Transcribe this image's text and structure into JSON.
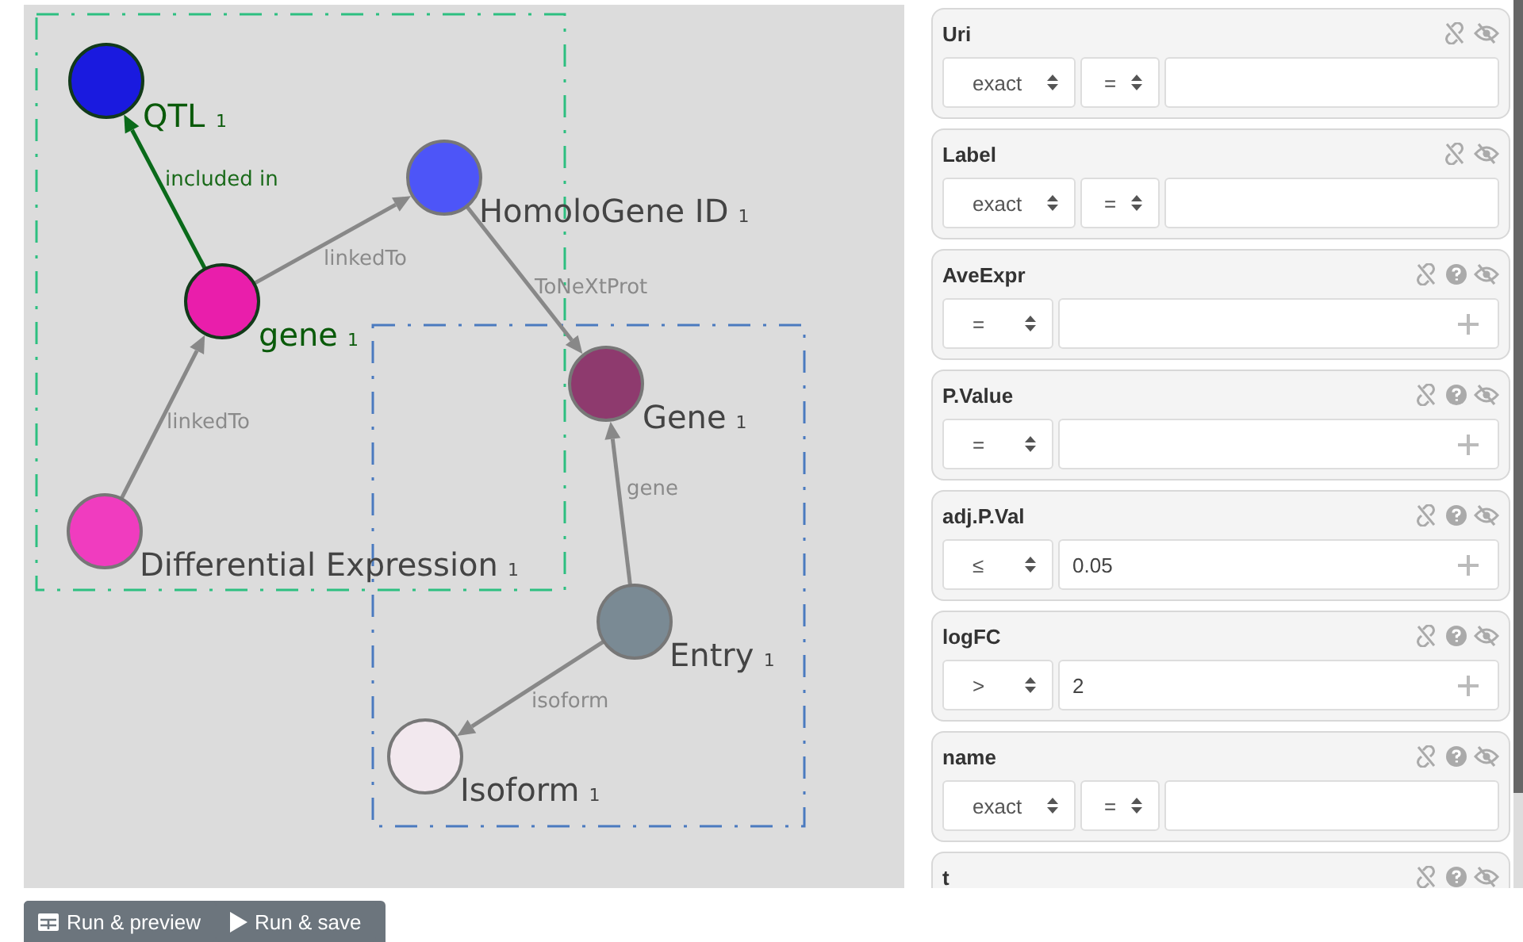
{
  "graph": {
    "groups": [
      {
        "color": "#2dbf80"
      },
      {
        "color": "#4a7abf"
      }
    ],
    "nodes": [
      {
        "label": "QTL",
        "count": "1",
        "color": "#1a1adf",
        "highlighted": true
      },
      {
        "label": "HomoloGene ID",
        "count": "1",
        "color": "#4d55f8",
        "highlighted": false
      },
      {
        "label": "gene",
        "count": "1",
        "color": "#e91eab",
        "highlighted": true
      },
      {
        "label": "Gene",
        "count": "1",
        "color": "#8e3a6e",
        "highlighted": false
      },
      {
        "label": "Differential Expression",
        "count": "1",
        "color": "#f03cbf",
        "highlighted": false
      },
      {
        "label": "Entry",
        "count": "1",
        "color": "#7a8a94",
        "highlighted": false
      },
      {
        "label": "Isoform",
        "count": "1",
        "color": "#f2e8ee",
        "highlighted": false
      }
    ],
    "edges": [
      {
        "label": "included in",
        "highlighted": true
      },
      {
        "label": "linkedTo",
        "highlighted": false
      },
      {
        "label": "ToNeXtProt",
        "highlighted": false
      },
      {
        "label": "linkedTo",
        "highlighted": false
      },
      {
        "label": "gene",
        "highlighted": false
      },
      {
        "label": "isoform",
        "highlighted": false
      }
    ]
  },
  "filters": [
    {
      "title": "Uri",
      "kind": "text",
      "help": false,
      "match": "exact",
      "operator": "="
    },
    {
      "title": "Label",
      "kind": "text",
      "help": false,
      "match": "exact",
      "operator": "="
    },
    {
      "title": "AveExpr",
      "kind": "number",
      "help": true,
      "operator": "="
    },
    {
      "title": "P.Value",
      "kind": "number",
      "help": true,
      "operator": "="
    },
    {
      "title": "adj.P.Val",
      "kind": "number",
      "help": true,
      "operator": "≤",
      "value": "0.05"
    },
    {
      "title": "logFC",
      "kind": "number",
      "help": true,
      "operator": ">",
      "value": "2"
    },
    {
      "title": "name",
      "kind": "text",
      "help": true,
      "match": "exact",
      "operator": "="
    },
    {
      "title": "t",
      "kind": "clipped",
      "help": true
    }
  ],
  "buttons": [
    {
      "label": "Run & preview",
      "kind": "preview"
    },
    {
      "label": "Run & save",
      "kind": "save"
    }
  ]
}
